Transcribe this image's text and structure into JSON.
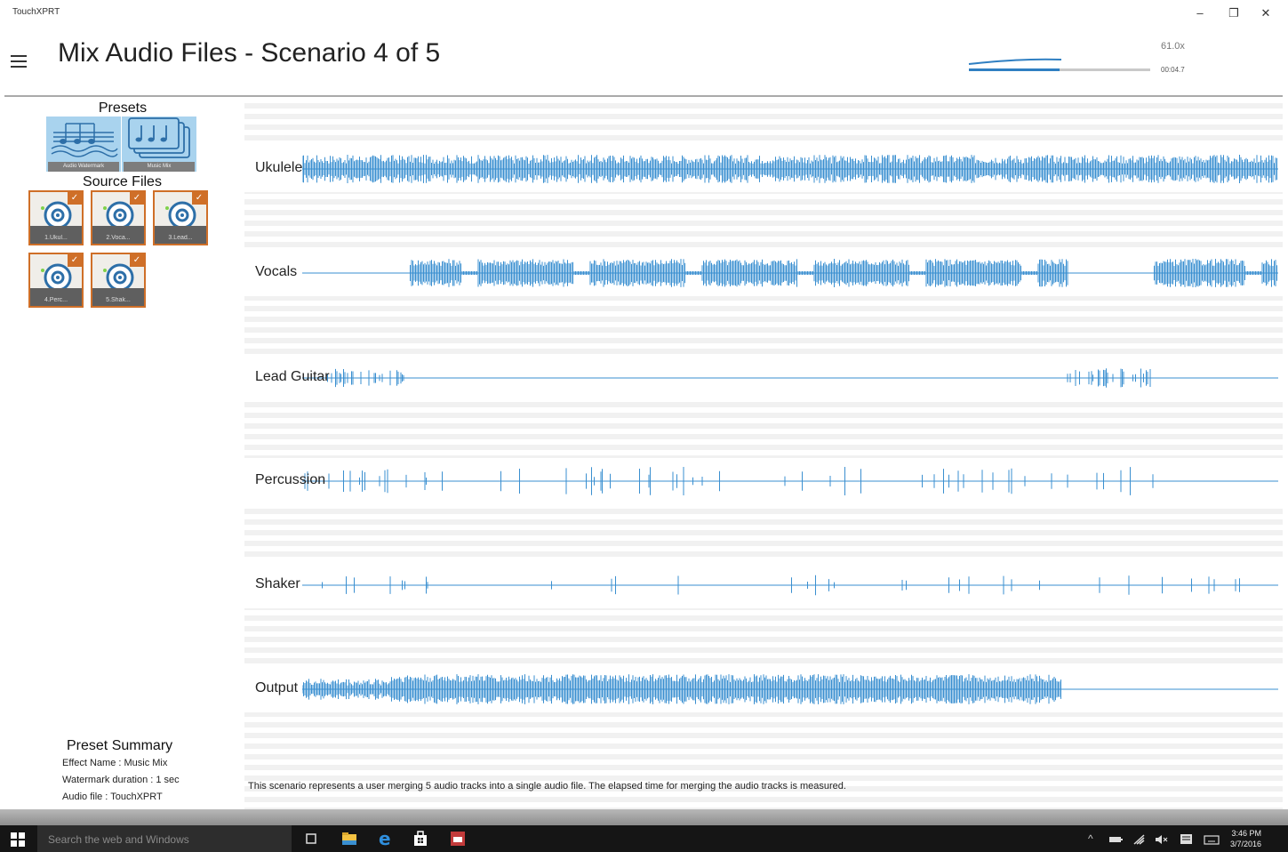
{
  "window": {
    "app_title": "TouchXPRT",
    "minimize": "–",
    "restore": "❐",
    "close": "✕"
  },
  "header": {
    "title": "Mix Audio Files - Scenario 4 of 5",
    "speed": "61.0x",
    "elapsed": "00:04.7",
    "progress": 0.5
  },
  "sidebar": {
    "presets_heading": "Presets",
    "presets": [
      {
        "label": "Audio Watermark",
        "icon": "music-staff-icon"
      },
      {
        "label": "Music Mix",
        "icon": "music-notes-stack-icon"
      }
    ],
    "source_heading": "Source Files",
    "sources": [
      {
        "label": "1.Ukul...",
        "checked": true
      },
      {
        "label": "2.Voca...",
        "checked": true
      },
      {
        "label": "3.Lead...",
        "checked": true
      },
      {
        "label": "4.Perc...",
        "checked": true
      },
      {
        "label": "5.Shak...",
        "checked": true
      }
    ],
    "summary": {
      "title": "Preset Summary",
      "effect": "Effect Name : Music Mix",
      "watermark": "Watermark duration : 1 sec",
      "audio": "Audio file : TouchXPRT"
    }
  },
  "tracks": [
    {
      "name": "Ukulele",
      "pattern": "dense"
    },
    {
      "name": "Vocals",
      "pattern": "vocal"
    },
    {
      "name": "Lead Guitar",
      "pattern": "sparse"
    },
    {
      "name": "Percussion",
      "pattern": "spiky"
    },
    {
      "name": "Shaker",
      "pattern": "spiky-light"
    },
    {
      "name": "Output",
      "pattern": "output"
    }
  ],
  "description": "This scenario represents a user merging 5 audio tracks into a single audio file. The elapsed time for merging the audio tracks is measured.",
  "taskbar": {
    "search_placeholder": "Search the web and Windows",
    "time": "3:46 PM",
    "date": "3/7/2016",
    "wave_color": "#3a8fd0"
  }
}
